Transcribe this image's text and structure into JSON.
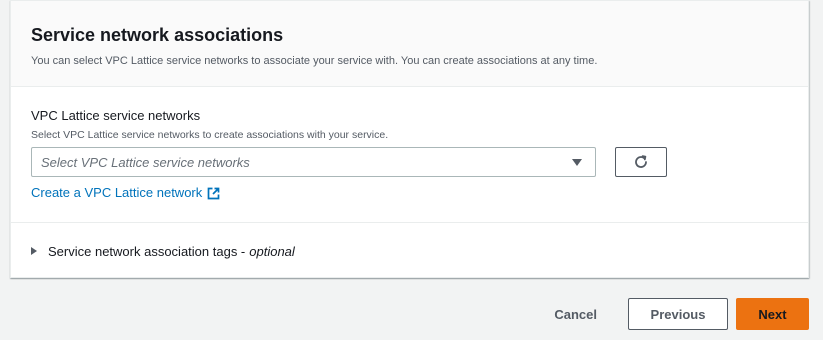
{
  "section": {
    "title": "Service network associations",
    "description": "You can select VPC Lattice service networks to associate your service with. You can create associations at any time."
  },
  "field": {
    "label": "VPC Lattice service networks",
    "description": "Select VPC Lattice service networks to create associations with your service.",
    "placeholder": "Select VPC Lattice service networks",
    "create_link": "Create a VPC Lattice network"
  },
  "tags": {
    "label": "Service network association tags -",
    "optional": "optional"
  },
  "actions": {
    "cancel": "Cancel",
    "previous": "Previous",
    "next": "Next"
  },
  "colors": {
    "link": "#0073bb",
    "primary_button": "#ec7211"
  },
  "icons": {
    "refresh": "refresh-icon",
    "external_link": "external-link-icon",
    "dropdown": "caret-down-icon",
    "expand": "caret-right-icon"
  }
}
